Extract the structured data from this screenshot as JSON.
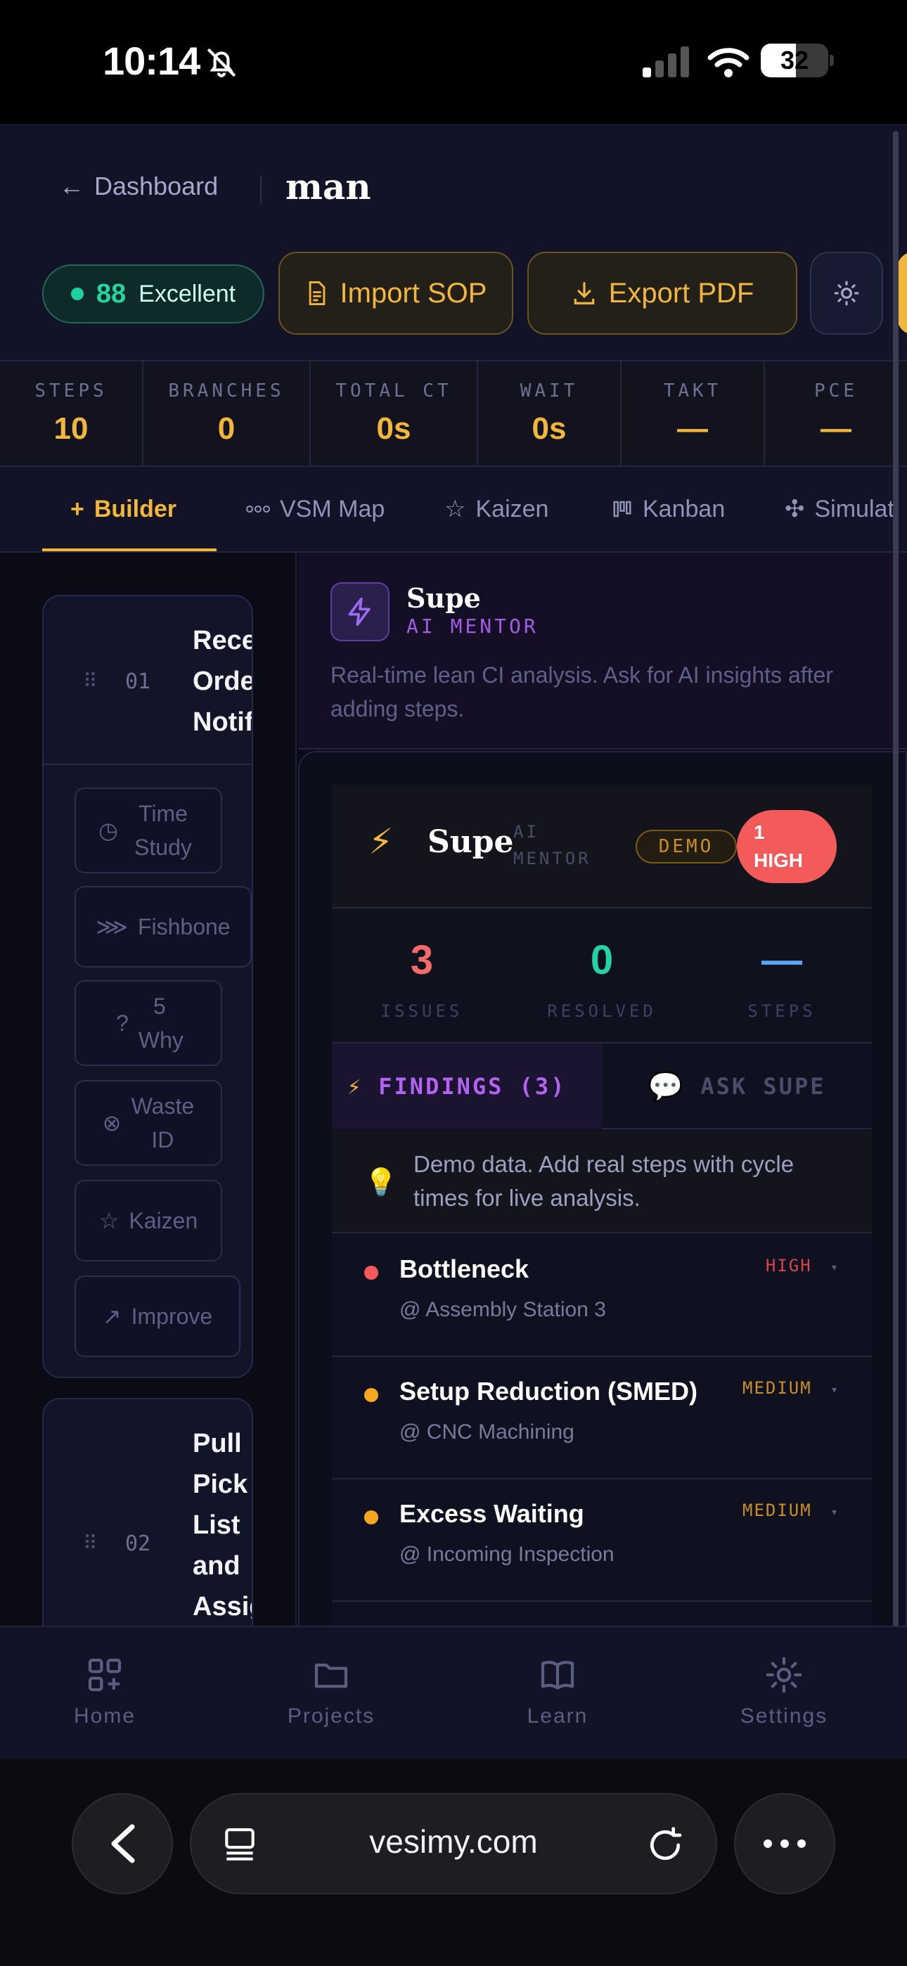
{
  "status_bar": {
    "time": "10:14",
    "battery": "32"
  },
  "header": {
    "back_label": "Dashboard",
    "project_name": "man",
    "score": {
      "value": "88",
      "label": "Excellent"
    },
    "import_label": "Import SOP",
    "export_label": "Export PDF"
  },
  "stats": [
    {
      "label": "STEPS",
      "value": "10"
    },
    {
      "label": "BRANCHES",
      "value": "0"
    },
    {
      "label": "TOTAL CT",
      "value": "0s"
    },
    {
      "label": "WAIT",
      "value": "0s"
    },
    {
      "label": "TAKT",
      "value": "—"
    },
    {
      "label": "PCE",
      "value": "—"
    }
  ],
  "tabs": [
    {
      "label": "Builder",
      "icon": "plus-icon"
    },
    {
      "label": "VSM Map",
      "icon": "nodes-icon"
    },
    {
      "label": "Kaizen",
      "icon": "star-icon"
    },
    {
      "label": "Kanban",
      "icon": "kanban-icon"
    },
    {
      "label": "Simulati",
      "icon": "sim-icon"
    }
  ],
  "steps": [
    {
      "number": "01",
      "title_lines": [
        "Rece",
        "Orde",
        "Notif"
      ],
      "tools": [
        {
          "label": "Time Study",
          "icon": "stopwatch-icon"
        },
        {
          "label": "Fishbone",
          "icon": "fishbone-icon"
        },
        {
          "label": "5 Why",
          "icon": "question-icon"
        },
        {
          "label": "Waste ID",
          "icon": "waste-icon"
        },
        {
          "label": "Kaizen",
          "icon": "star-icon"
        },
        {
          "label": "Improve",
          "icon": "trend-icon"
        }
      ]
    },
    {
      "number": "02",
      "title_lines": [
        "Pull",
        "Pick",
        "List",
        "and",
        "Assig"
      ]
    }
  ],
  "mentor": {
    "name": "Supe",
    "subtitle": "AI MENTOR",
    "description": "Real-time lean CI analysis. Ask for AI insights after adding steps."
  },
  "card": {
    "name": "Supe",
    "subtitle_line1": "AI",
    "subtitle_line2": "MENTOR",
    "demo_badge": "DEMO",
    "high_badge_line1": "1",
    "high_badge_line2": "HIGH",
    "metrics": [
      {
        "value": "3",
        "label": "ISSUES",
        "color": "#f36a6a"
      },
      {
        "value": "0",
        "label": "RESOLVED",
        "color": "#23d3a3"
      },
      {
        "value": "—",
        "label": "STEPS",
        "color": "#5aa7f5"
      }
    ],
    "findings_tab": "FINDINGS (3)",
    "ask_tab": "ASK SUPE",
    "demo_note": "Demo data. Add real steps with cycle times for live analysis.",
    "findings": [
      {
        "title": "Bottleneck",
        "location": "@ Assembly Station 3",
        "severity": "HIGH",
        "color": "#f35b5b"
      },
      {
        "title": "Setup Reduction (SMED)",
        "location": "@ CNC Machining",
        "severity": "MEDIUM",
        "color": "#f5a623"
      },
      {
        "title": "Excess Waiting",
        "location": "@ Incoming Inspection",
        "severity": "MEDIUM",
        "color": "#f5a623"
      }
    ]
  },
  "bottom_nav": [
    {
      "label": "Home",
      "icon": "grid-plus-icon"
    },
    {
      "label": "Projects",
      "icon": "folder-icon"
    },
    {
      "label": "Learn",
      "icon": "book-icon"
    },
    {
      "label": "Settings",
      "icon": "gear-icon"
    }
  ],
  "browser": {
    "url": "vesimy.com"
  },
  "colors": {
    "accent": "#f2b73a",
    "purple": "#b463f0",
    "background": "#0b0c18"
  }
}
